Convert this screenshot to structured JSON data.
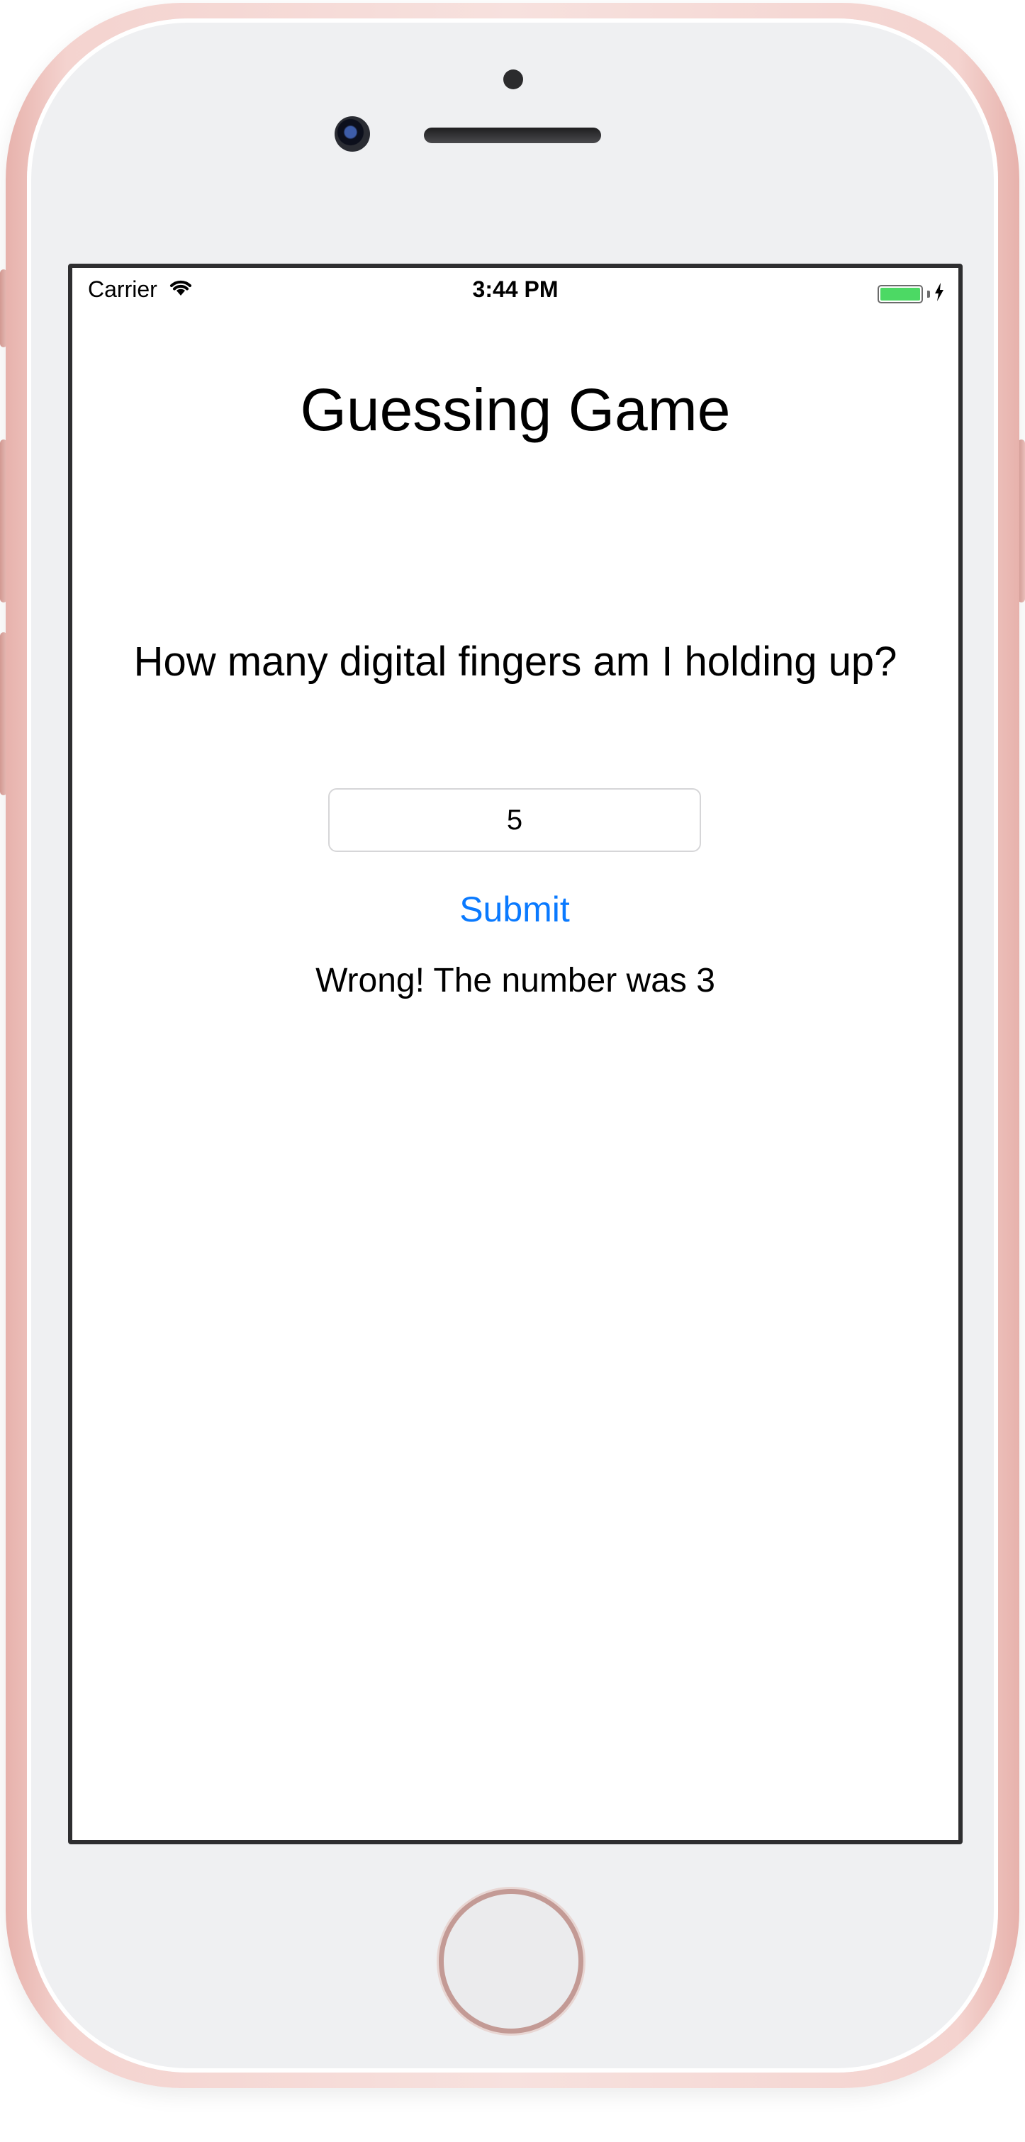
{
  "status_bar": {
    "carrier": "Carrier",
    "time": "3:44 PM",
    "wifi_icon": "wifi-icon",
    "battery_icon": "battery-icon",
    "charging_icon": "bolt-icon",
    "battery_color": "#4cd964"
  },
  "app": {
    "title": "Guessing Game",
    "question": "How many digital fingers am I holding up?",
    "guess_input": {
      "value": "5",
      "placeholder": ""
    },
    "submit_label": "Submit",
    "result_text": "Wrong! The number was 3",
    "accent_color": "#0a7aff"
  },
  "device": {
    "color": "rose gold"
  }
}
